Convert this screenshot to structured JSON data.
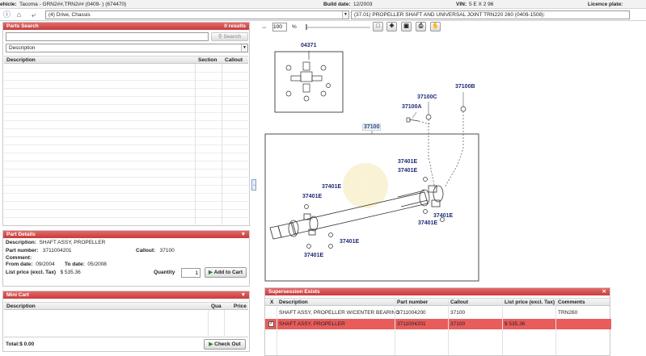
{
  "infobar": {
    "vehicle_label": "ehicle:",
    "vehicle_value": "Tacoma - GRN2##,TRN2## (0409-    ) (674470)",
    "build_label": "Build date:",
    "build_value": "12/2003",
    "vin_label": "VIN:",
    "vin_value": "5 E X 2 96",
    "licence_label": "Licence plate:"
  },
  "navbar": {
    "group_select": "(4) Drive, Chassis",
    "illustration_select": "(37.01) PROPELLER SHAFT AND UNIVERSAL JOINT TRN220 260 (0409-1508):"
  },
  "toolbar": {
    "zoom_value": "100",
    "zoom_unit": "%"
  },
  "parts_search": {
    "title": "Parts Search",
    "results": "0 results",
    "search_value": "",
    "search_button": "Search",
    "filter_select": "Description",
    "columns": [
      "Description",
      "Section",
      "Callout"
    ]
  },
  "part_details": {
    "title": "Part Details",
    "description_label": "Description:",
    "description_value": "SHAFT ASSY, PROPELLER",
    "part_number_label": "Part number:",
    "part_number_value": "3711004201",
    "callout_label": "Callout:",
    "callout_value": "37100",
    "comment_label": "Comment:",
    "from_date_label": "From date:",
    "from_date_value": "09/2004",
    "to_date_label": "To date:",
    "to_date_value": "05/2008",
    "list_price_label": "List price (excl. Tax)",
    "list_price_value": "$ 535.36",
    "quantity_label": "Quantity",
    "quantity_value": "1",
    "add_to_cart_button": "Add to Cart"
  },
  "mini_cart": {
    "title": "Mini Cart",
    "columns": [
      "Description",
      "Qua",
      "Price"
    ],
    "total_label": "Total:",
    "total_value": "$ 0.00",
    "checkout_button": "Check Out"
  },
  "diagram": {
    "callouts": {
      "c04371": "04371",
      "c37100B": "37100B",
      "c37100C": "37100C",
      "c37100A": "37100A",
      "c37100": "37100",
      "e1": "37401E",
      "e2": "37401E",
      "e3": "37401E",
      "e4": "37401E",
      "e5": "37401E",
      "e6": "37401E",
      "e7": "37401E",
      "e8": "37401E"
    }
  },
  "supersession": {
    "title": "Supersession Exists",
    "columns": [
      "X",
      "Description",
      "Part number",
      "Callout",
      "List price (excl. Tax)",
      "Comments"
    ],
    "rows": [
      {
        "description": "SHAFT ASSY, PROPELLER W/CENTER BEARING",
        "part_number": "3711004200",
        "callout": "37100",
        "price": "",
        "comments": "TRN260"
      },
      {
        "description": "SHAFT ASSY, PROPELLER",
        "part_number": "3711004201",
        "callout": "37100",
        "price": "$ 535.36",
        "comments": ""
      }
    ]
  },
  "colors": {
    "header_red": "#c83b3b",
    "selected_row": "#e85c5c",
    "callout_blue": "#1c2a7a"
  }
}
